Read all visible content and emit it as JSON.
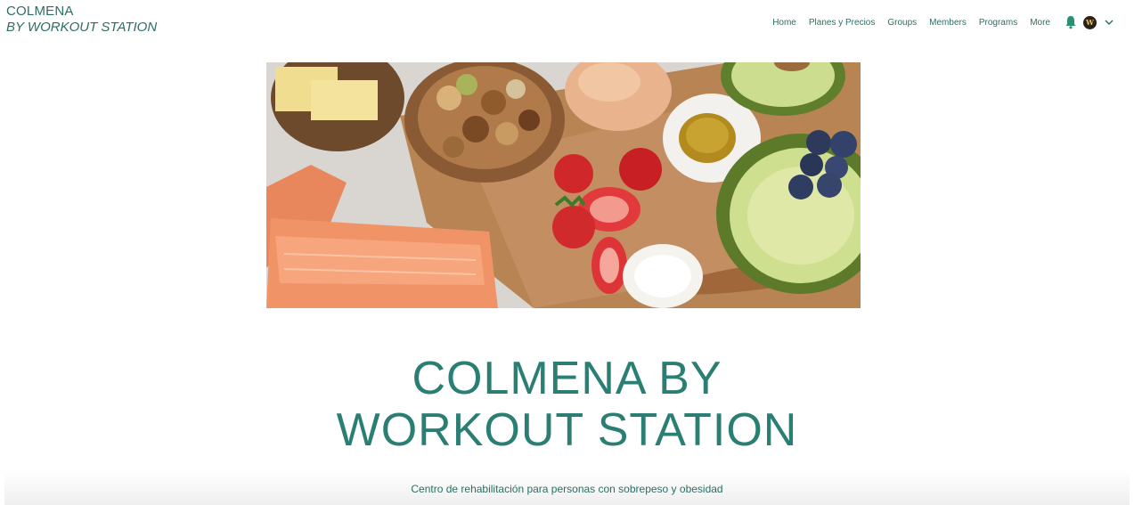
{
  "site": {
    "logo_line1": "COLMENA",
    "logo_line2": "BY WORKOUT STATION"
  },
  "nav": {
    "items": [
      {
        "label": "Home"
      },
      {
        "label": "Planes y Precios"
      },
      {
        "label": "Groups"
      },
      {
        "label": "Members"
      },
      {
        "label": "Programs"
      },
      {
        "label": "More"
      }
    ],
    "bell_icon": "bell-icon",
    "avatar_letter": "W",
    "dropdown_icon": "chevron-down-icon"
  },
  "hero": {
    "headline_line1": "COLMENA BY",
    "headline_line2": "WORKOUT STATION",
    "subtitle": "Centro de rehabilitación para personas con sobrepeso y obesidad"
  },
  "colors": {
    "accent": "#2b6f64",
    "headline": "#2b7e72",
    "background": "#ffffff"
  }
}
